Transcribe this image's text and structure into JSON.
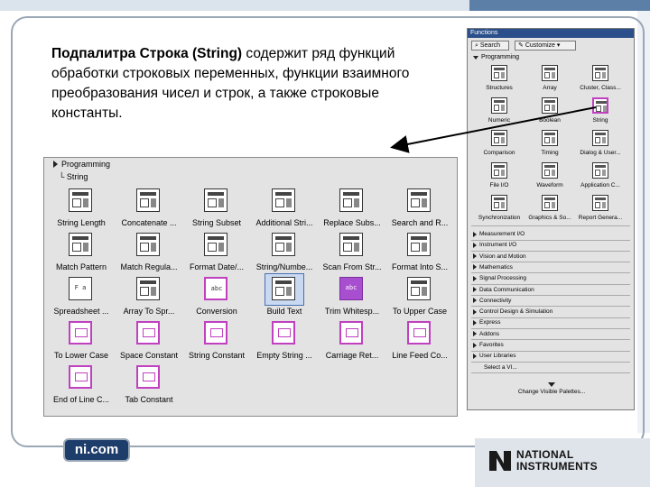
{
  "slide": {
    "description_bold": "Подпалитра Строка (String)",
    "description_rest": " содержит ряд функций обработки строковых переменных, функции взаимного преобразования чисел и строк, а также строковые константы.",
    "footer_link": "ni.com",
    "logo_line1": "NATIONAL",
    "logo_line2": "INSTRUMENTS"
  },
  "string_palette": {
    "breadcrumb_root": "Programming",
    "breadcrumb_child": "└ String",
    "items": [
      {
        "label": "String Length",
        "icon": "string-length-icon"
      },
      {
        "label": "Concatenate ...",
        "icon": "concatenate-icon"
      },
      {
        "label": "String Subset",
        "icon": "string-subset-icon"
      },
      {
        "label": "Additional Stri...",
        "icon": "additional-string-icon"
      },
      {
        "label": "Replace Subs...",
        "icon": "replace-substring-icon"
      },
      {
        "label": "Search and R...",
        "icon": "search-replace-icon"
      },
      {
        "label": "Match Pattern",
        "icon": "match-pattern-icon"
      },
      {
        "label": "Match Regula...",
        "icon": "match-regex-icon"
      },
      {
        "label": "Format Date/...",
        "icon": "format-date-icon"
      },
      {
        "label": "String/Numbe...",
        "icon": "string-number-icon"
      },
      {
        "label": "Scan From Str...",
        "icon": "scan-from-string-icon"
      },
      {
        "label": "Format Into S...",
        "icon": "format-into-string-icon"
      },
      {
        "label": "Spreadsheet ...",
        "icon": "spreadsheet-icon"
      },
      {
        "label": "Array To Spr...",
        "icon": "array-to-spreadsheet-icon"
      },
      {
        "label": "Conversion",
        "icon": "conversion-icon"
      },
      {
        "label": "Build Text",
        "icon": "build-text-icon"
      },
      {
        "label": "Trim Whitesp...",
        "icon": "trim-whitespace-icon"
      },
      {
        "label": "To Upper Case",
        "icon": "to-upper-case-icon"
      },
      {
        "label": "To Lower Case",
        "icon": "to-lower-case-icon"
      },
      {
        "label": "Space Constant",
        "icon": "space-constant-icon"
      },
      {
        "label": "String Constant",
        "icon": "string-constant-icon"
      },
      {
        "label": "Empty String ...",
        "icon": "empty-string-icon"
      },
      {
        "label": "Carriage Ret...",
        "icon": "carriage-return-icon"
      },
      {
        "label": "Line Feed Co...",
        "icon": "line-feed-icon"
      },
      {
        "label": "End of Line C...",
        "icon": "end-of-line-icon"
      },
      {
        "label": "Tab Constant",
        "icon": "tab-constant-icon"
      }
    ],
    "icon_texts": {
      "fa": "F a",
      "abc_purple": "abc",
      "abc": "abc",
      "abc2": "a b c"
    }
  },
  "functions_palette": {
    "title": "Functions",
    "search_label": "Search",
    "customize_label": "Customize",
    "section": "Programming",
    "items": [
      {
        "label": "Structures"
      },
      {
        "label": "Array"
      },
      {
        "label": "Cluster, Class..."
      },
      {
        "label": "Numeric"
      },
      {
        "label": "Boolean"
      },
      {
        "label": "String"
      },
      {
        "label": "Comparison"
      },
      {
        "label": "Timing"
      },
      {
        "label": "Dialog & User..."
      },
      {
        "label": "File I/O"
      },
      {
        "label": "Waveform"
      },
      {
        "label": "Application C..."
      },
      {
        "label": "Synchronization"
      },
      {
        "label": "Graphics & So..."
      },
      {
        "label": "Report Genera..."
      }
    ],
    "categories": [
      "Measurement I/O",
      "Instrument I/O",
      "Vision and Motion",
      "Mathematics",
      "Signal Processing",
      "Data Communication",
      "Connectivity",
      "Control Design & Simulation",
      "Express",
      "Addons",
      "Favorites",
      "User Libraries",
      "Select a VI..."
    ],
    "bottom_label": "Change Visible Palettes..."
  },
  "colors": {
    "frame": "#9aa7b5",
    "palette_bg": "#e3e3e3",
    "string_pink": "#c040c0",
    "arrow": "#000000",
    "title_bar": "#2b4f8a"
  }
}
